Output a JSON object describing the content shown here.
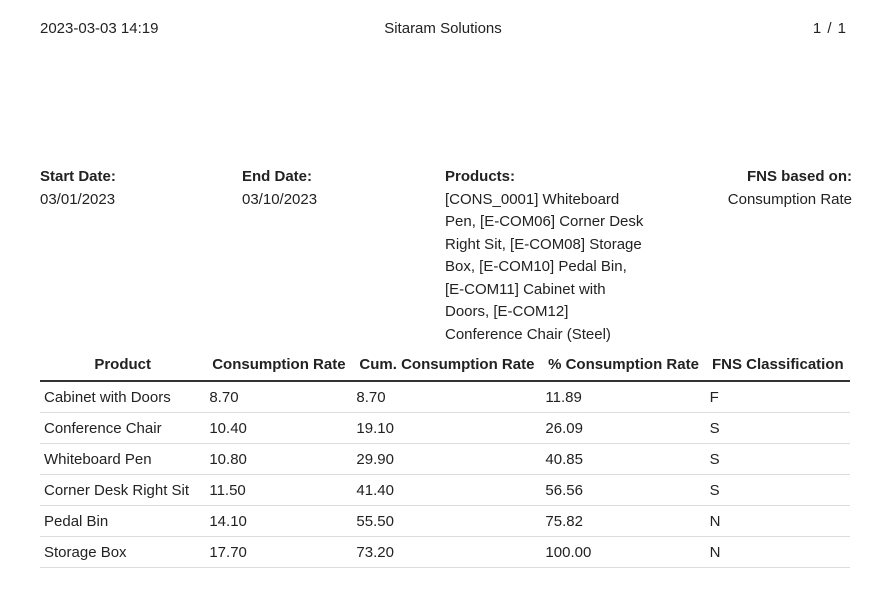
{
  "header": {
    "datetime": "2023-03-03 14:19",
    "company": "Sitaram Solutions",
    "pager": "1 / 1"
  },
  "filters": {
    "start_date": {
      "label": "Start Date:",
      "value": "03/01/2023"
    },
    "end_date": {
      "label": "End Date:",
      "value": "03/10/2023"
    },
    "products": {
      "label": "Products:",
      "value": "[CONS_0001] Whiteboard Pen, [E-COM06] Corner Desk Right Sit, [E-COM08] Storage Box, [E-COM10] Pedal Bin, [E-COM11] Cabinet with Doors, [E-COM12] Conference Chair (Steel)"
    },
    "fns_based_on": {
      "label": "FNS based on:",
      "value": "Consumption Rate"
    }
  },
  "table": {
    "columns": [
      "Product",
      "Consumption Rate",
      "Cum. Consumption Rate",
      "% Consumption Rate",
      "FNS Classification"
    ],
    "rows": [
      [
        "Cabinet with Doors",
        "8.70",
        "8.70",
        "11.89",
        "F"
      ],
      [
        "Conference Chair",
        "10.40",
        "19.10",
        "26.09",
        "S"
      ],
      [
        "Whiteboard Pen",
        "10.80",
        "29.90",
        "40.85",
        "S"
      ],
      [
        "Corner Desk Right Sit",
        "11.50",
        "41.40",
        "56.56",
        "S"
      ],
      [
        "Pedal Bin",
        "14.10",
        "55.50",
        "75.82",
        "N"
      ],
      [
        "Storage Box",
        "17.70",
        "73.20",
        "100.00",
        "N"
      ]
    ]
  }
}
